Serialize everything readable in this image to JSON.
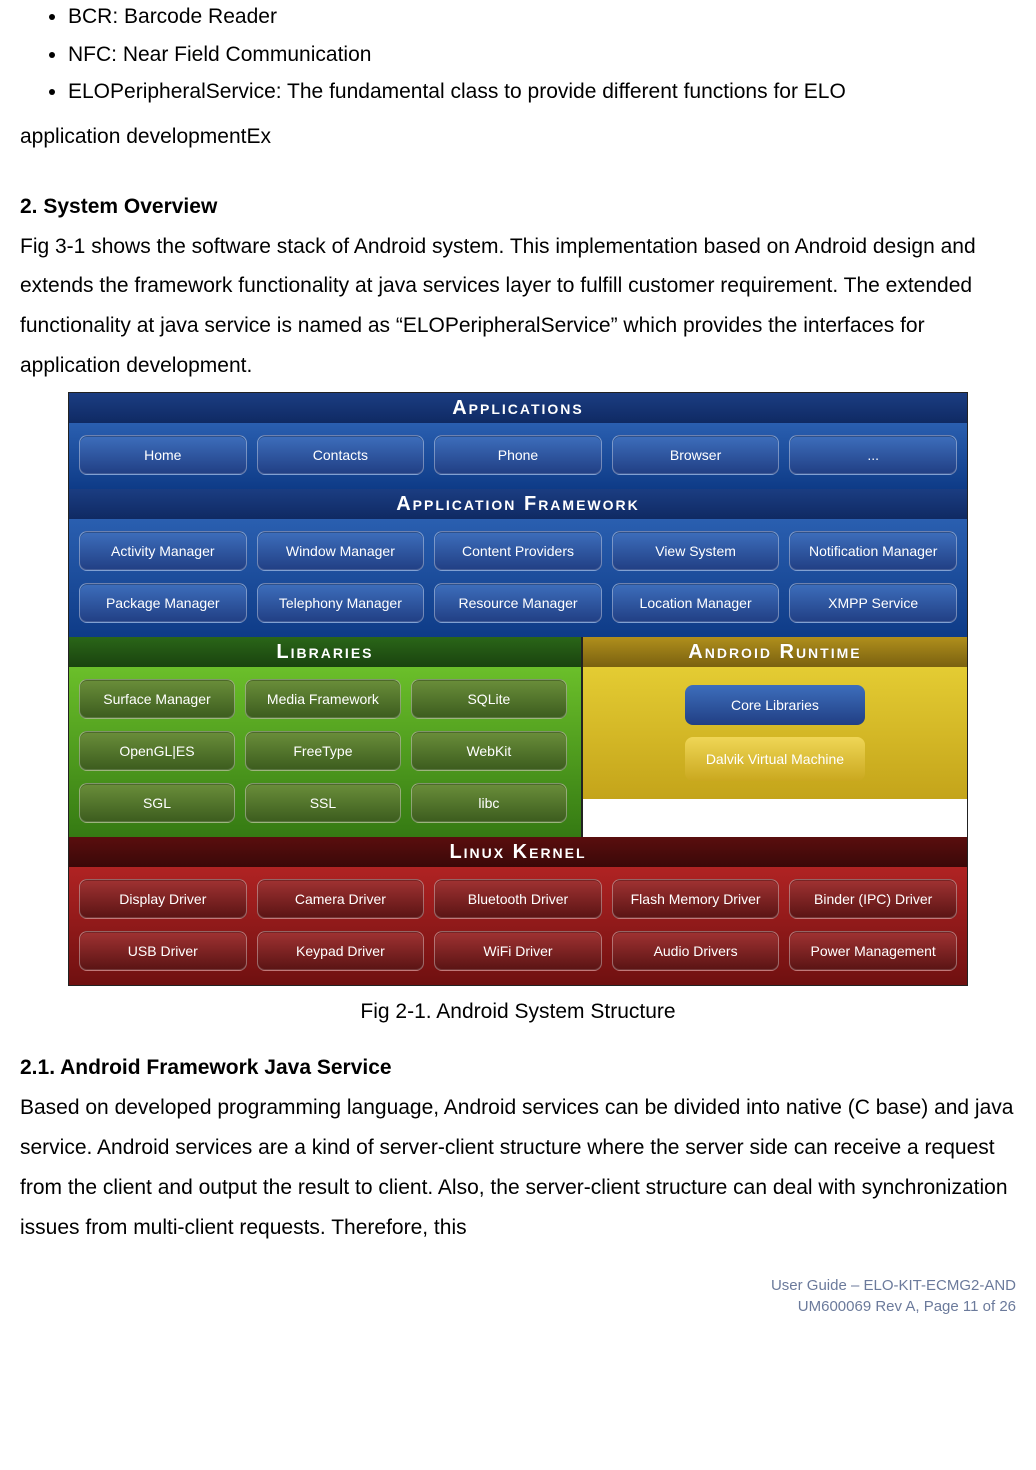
{
  "bullets": {
    "b1": "BCR: Barcode Reader",
    "b2": "NFC: Near Field Communication",
    "b3": "ELOPeripheralService: The fundamental class to provide different functions for ELO"
  },
  "bullets_cont": "application developmentEx",
  "section2": {
    "heading": "2.   System Overview",
    "paragraph": "Fig 3-1 shows the software stack of Android system. This implementation based on Android design and extends the framework functionality at java services layer to fulfill customer requirement. The extended functionality at java service is named as “ELOPeripheralService” which provides the interfaces for application development."
  },
  "diagram": {
    "apps_title": "Applications",
    "apps_row1": [
      "Home",
      "Contacts",
      "Phone",
      "Browser",
      "..."
    ],
    "fw_title": "Application Framework",
    "fw_row1": [
      "Activity Manager",
      "Window Manager",
      "Content Providers",
      "View System",
      "Notification Manager"
    ],
    "fw_row2": [
      "Package Manager",
      "Telephony Manager",
      "Resource Manager",
      "Location Manager",
      "XMPP Service"
    ],
    "libs_title": "Libraries",
    "libs_row1": [
      "Surface Manager",
      "Media Framework",
      "SQLite"
    ],
    "libs_row2": [
      "OpenGL|ES",
      "FreeType",
      "WebKit"
    ],
    "libs_row3": [
      "SGL",
      "SSL",
      "libc"
    ],
    "runtime_title": "Android Runtime",
    "runtime_items": [
      "Core Libraries",
      "Dalvik Virtual Machine"
    ],
    "kernel_title": "Linux Kernel",
    "kernel_row1": [
      "Display Driver",
      "Camera Driver",
      "Bluetooth Driver",
      "Flash Memory Driver",
      "Binder (IPC) Driver"
    ],
    "kernel_row2": [
      "USB Driver",
      "Keypad Driver",
      "WiFi Driver",
      "Audio Drivers",
      "Power Management"
    ]
  },
  "caption": "Fig 2-1. Android System Structure",
  "section21": {
    "heading": "2.1. Android Framework Java Service",
    "paragraph": "Based on developed programming language, Android services can be divided into native (C base) and java service. Android services are a kind of server-client structure where the server side can receive a request from the client and output the result to client. Also, the server-client structure can deal with synchronization issues from multi-client requests. Therefore, this"
  },
  "footer": {
    "line1": "User  Guide  –  ELO-KIT-ECMG2-AND",
    "line2": "UM600069  Rev  A,  Page  11  of  26"
  }
}
